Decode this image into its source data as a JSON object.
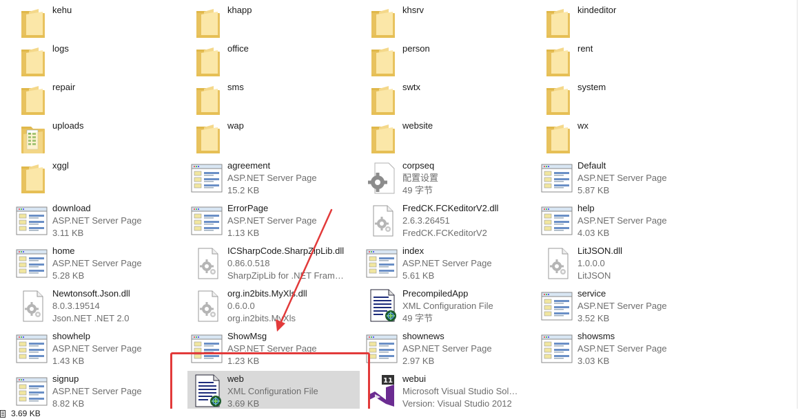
{
  "status_bar": {
    "selected_size": "3.69 KB"
  },
  "colors": {
    "highlight": "#e23a3a",
    "selection": "#d9d9d9"
  },
  "items": [
    {
      "name": "kehu",
      "icon": "folder",
      "lines": [
        "kehu"
      ]
    },
    {
      "name": "khapp",
      "icon": "folder",
      "lines": [
        "khapp"
      ]
    },
    {
      "name": "khsrv",
      "icon": "folder",
      "lines": [
        "khsrv"
      ]
    },
    {
      "name": "kindeditor",
      "icon": "folder",
      "lines": [
        "kindeditor"
      ]
    },
    {
      "name": "logs",
      "icon": "folder",
      "lines": [
        "logs"
      ]
    },
    {
      "name": "office",
      "icon": "folder",
      "lines": [
        "office"
      ]
    },
    {
      "name": "person",
      "icon": "folder",
      "lines": [
        "person"
      ]
    },
    {
      "name": "rent",
      "icon": "folder",
      "lines": [
        "rent"
      ]
    },
    {
      "name": "repair",
      "icon": "folder",
      "lines": [
        "repair"
      ]
    },
    {
      "name": "sms",
      "icon": "folder",
      "lines": [
        "sms"
      ]
    },
    {
      "name": "swtx",
      "icon": "folder",
      "lines": [
        "swtx"
      ]
    },
    {
      "name": "system",
      "icon": "folder",
      "lines": [
        "system"
      ]
    },
    {
      "name": "uploads",
      "icon": "folder-sheet",
      "lines": [
        "uploads"
      ]
    },
    {
      "name": "wap",
      "icon": "folder",
      "lines": [
        "wap"
      ]
    },
    {
      "name": "website",
      "icon": "folder",
      "lines": [
        "website"
      ]
    },
    {
      "name": "wx",
      "icon": "folder",
      "lines": [
        "wx"
      ]
    },
    {
      "name": "xggl",
      "icon": "folder",
      "lines": [
        "xggl"
      ]
    },
    {
      "name": "agreement",
      "icon": "aspx",
      "lines": [
        "agreement",
        "ASP.NET Server Page",
        "15.2 KB"
      ]
    },
    {
      "name": "corpseq",
      "icon": "config-gear",
      "lines": [
        "corpseq",
        "配置设置",
        "49 字节"
      ]
    },
    {
      "name": "Default",
      "icon": "aspx",
      "lines": [
        "Default",
        "ASP.NET Server Page",
        "5.87 KB"
      ]
    },
    {
      "name": "download",
      "icon": "aspx",
      "lines": [
        "download",
        "ASP.NET Server Page",
        "3.11 KB"
      ]
    },
    {
      "name": "ErrorPage",
      "icon": "aspx",
      "lines": [
        "ErrorPage",
        "ASP.NET Server Page",
        "1.13 KB"
      ]
    },
    {
      "name": "FredCK.FCKeditorV2.dll",
      "icon": "dll",
      "lines": [
        "FredCK.FCKeditorV2.dll",
        "2.6.3.26451",
        "FredCK.FCKeditorV2"
      ]
    },
    {
      "name": "help",
      "icon": "aspx",
      "lines": [
        "help",
        "ASP.NET Server Page",
        "4.03 KB"
      ]
    },
    {
      "name": "home",
      "icon": "aspx",
      "lines": [
        "home",
        "ASP.NET Server Page",
        "5.28 KB"
      ]
    },
    {
      "name": "ICSharpCode.SharpZipLib.dll",
      "icon": "dll",
      "lines": [
        "ICSharpCode.SharpZipLib.dll",
        "0.86.0.518",
        "SharpZipLib for .NET Framewo..."
      ]
    },
    {
      "name": "index",
      "icon": "aspx",
      "lines": [
        "index",
        "ASP.NET Server Page",
        "5.61 KB"
      ]
    },
    {
      "name": "LitJSON.dll",
      "icon": "dll",
      "lines": [
        "LitJSON.dll",
        "1.0.0.0",
        "LitJSON"
      ]
    },
    {
      "name": "Newtonsoft.Json.dll",
      "icon": "dll",
      "lines": [
        "Newtonsoft.Json.dll",
        "8.0.3.19514",
        "Json.NET .NET 2.0"
      ]
    },
    {
      "name": "org.in2bits.MyXls.dll",
      "icon": "dll",
      "lines": [
        "org.in2bits.MyXls.dll",
        "0.6.0.0",
        "org.in2bits.MyXls"
      ]
    },
    {
      "name": "PrecompiledApp",
      "icon": "xml",
      "lines": [
        "PrecompiledApp",
        "XML Configuration File",
        "49 字节"
      ]
    },
    {
      "name": "service",
      "icon": "aspx",
      "lines": [
        "service",
        "ASP.NET Server Page",
        "3.52 KB"
      ]
    },
    {
      "name": "showhelp",
      "icon": "aspx",
      "lines": [
        "showhelp",
        "ASP.NET Server Page",
        "1.43 KB"
      ]
    },
    {
      "name": "ShowMsg",
      "icon": "aspx",
      "lines": [
        "ShowMsg",
        "ASP.NET Server Page",
        "1.23 KB"
      ]
    },
    {
      "name": "shownews",
      "icon": "aspx",
      "lines": [
        "shownews",
        "ASP.NET Server Page",
        "2.97 KB"
      ]
    },
    {
      "name": "showsms",
      "icon": "aspx",
      "lines": [
        "showsms",
        "ASP.NET Server Page",
        "3.03 KB"
      ]
    },
    {
      "name": "signup",
      "icon": "aspx",
      "lines": [
        "signup",
        "ASP.NET Server Page",
        "8.82 KB"
      ]
    },
    {
      "name": "web",
      "icon": "xml",
      "selected": true,
      "lines": [
        "web",
        "XML Configuration File",
        "3.69 KB"
      ]
    },
    {
      "name": "webui",
      "icon": "vs-solution",
      "lines": [
        "webui",
        "Microsoft Visual Studio Solution",
        "Version: Visual Studio 2012"
      ]
    }
  ]
}
